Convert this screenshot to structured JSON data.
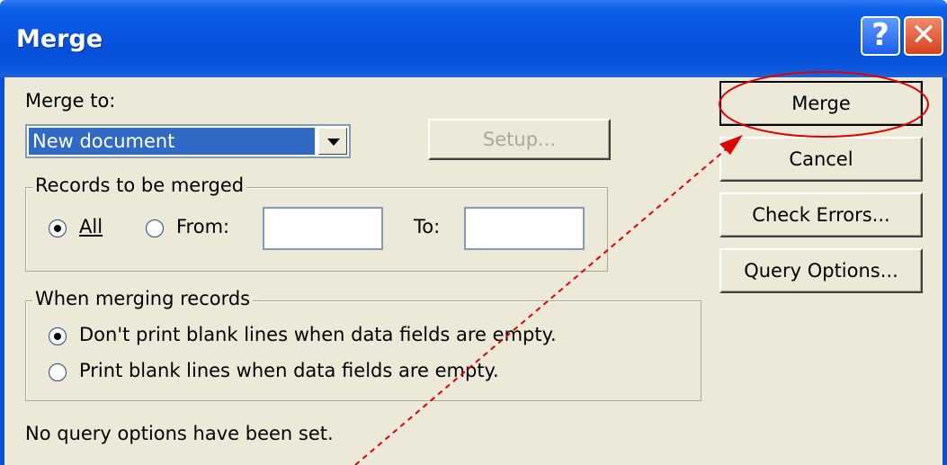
{
  "dialog": {
    "title": "Merge",
    "help_icon": "?",
    "close_icon": "✕"
  },
  "merge_to": {
    "label": "Merge to:",
    "selected": "New document",
    "setup_button": "Setup..."
  },
  "records": {
    "legend": "Records to be merged",
    "all_label": "All",
    "from_label": "From:",
    "to_label": "To:",
    "from_value": "",
    "to_value": ""
  },
  "blank_lines": {
    "legend": "When merging records",
    "option1": "Don't print blank lines when data fields are empty.",
    "option2": "Print blank lines when data fields are empty."
  },
  "status": "No query options have been set.",
  "buttons": {
    "merge": "Merge",
    "cancel": "Cancel",
    "check_errors": "Check Errors...",
    "query_options": "Query Options..."
  },
  "annotation": {
    "ellipse_color": "#e00000",
    "arrow_color": "#e00000"
  }
}
